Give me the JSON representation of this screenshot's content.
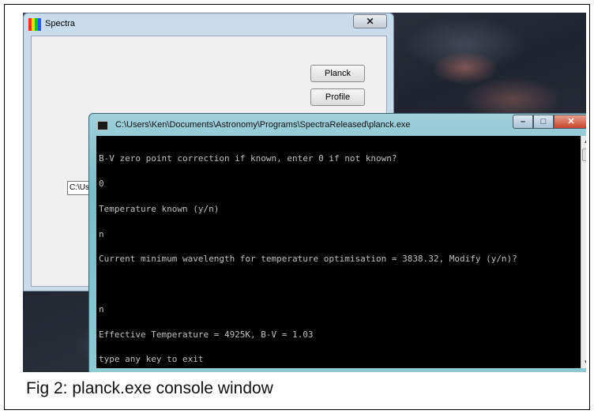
{
  "caption": "Fig 2: planck.exe console window",
  "spectra_window": {
    "title": "Spectra",
    "close_glyph": "✕",
    "icon_colors": [
      "#ff2b2b",
      "#ffd500",
      "#17c517",
      "#1e5bff"
    ],
    "buttons": {
      "planck": "Planck",
      "profile": "Profile"
    },
    "path_value": "C:\\Users\\Ken\\Documents"
  },
  "console_window": {
    "title": "C:\\Users\\Ken\\Documents\\Astronomy\\Programs\\SpectraReleased\\planck.exe",
    "minimize_glyph": "–",
    "maximize_glyph": "□",
    "close_glyph": "✕",
    "lines": [
      "B-V zero point correction if known, enter 0 if not known?",
      "0",
      "Temperature known (y/n)",
      "n",
      "Current minimum wavelength for temperature optimisation = 3838.32, Modify (y/n)?",
      "",
      "n",
      "Effective Temperature = 4925K, B-V = 1.03",
      "type any key to exit"
    ],
    "scroll_up_glyph": "▲",
    "scroll_down_glyph": "▼"
  },
  "colors": {
    "terminal_bg": "#000000",
    "terminal_fg": "#c0c0c0",
    "close_button": "#c9452d"
  }
}
